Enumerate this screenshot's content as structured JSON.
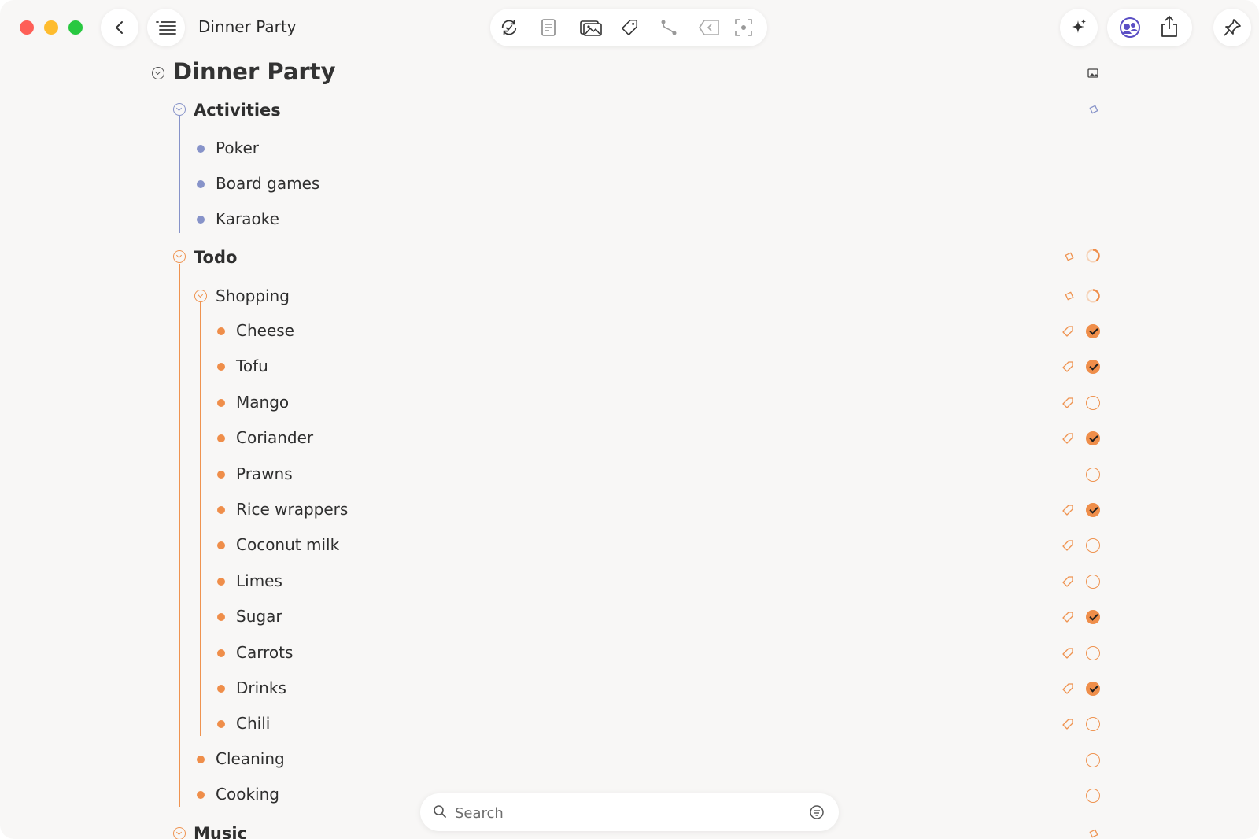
{
  "window": {
    "title": "Dinner Party",
    "toolbar_icons": [
      "sync-icon",
      "document-icon",
      "photos-icon",
      "tag-icon",
      "branch-icon",
      "back-link-icon",
      "focus-icon"
    ],
    "right_icons": [
      "sparkle-icon",
      "collaborate-icon",
      "share-icon",
      "pin-icon"
    ]
  },
  "colors": {
    "blue_accent": "#8793c9",
    "orange_accent": "#ef8e4a",
    "background": "#f8f7f6"
  },
  "outline": {
    "title": "Dinner Party",
    "activities": {
      "label": "Activities",
      "items": [
        "Poker",
        "Board games",
        "Karaoke"
      ]
    },
    "todo": {
      "label": "Todo",
      "shopping": {
        "label": "Shopping",
        "items": [
          {
            "label": "Cheese",
            "done": true,
            "tagged": true
          },
          {
            "label": "Tofu",
            "done": true,
            "tagged": true
          },
          {
            "label": "Mango",
            "done": false,
            "tagged": true
          },
          {
            "label": "Coriander",
            "done": true,
            "tagged": true
          },
          {
            "label": "Prawns",
            "done": false,
            "tagged": false
          },
          {
            "label": "Rice wrappers",
            "done": true,
            "tagged": true
          },
          {
            "label": "Coconut milk",
            "done": false,
            "tagged": true
          },
          {
            "label": "Limes",
            "done": false,
            "tagged": true
          },
          {
            "label": "Sugar",
            "done": true,
            "tagged": true
          },
          {
            "label": "Carrots",
            "done": false,
            "tagged": true
          },
          {
            "label": "Drinks",
            "done": true,
            "tagged": true
          },
          {
            "label": "Chili",
            "done": false,
            "tagged": true
          }
        ]
      },
      "cleaning": {
        "label": "Cleaning",
        "done": false
      },
      "cooking": {
        "label": "Cooking",
        "done": false
      }
    },
    "music": {
      "label": "Music"
    }
  },
  "search": {
    "placeholder": "Search",
    "value": ""
  }
}
